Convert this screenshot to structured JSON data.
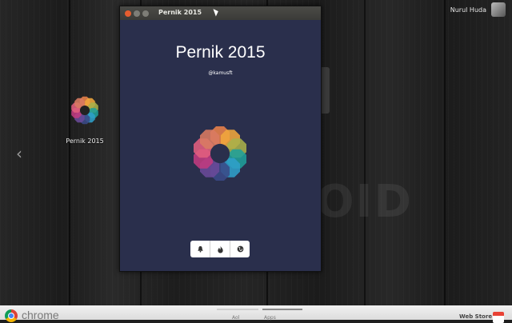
{
  "desktop": {
    "user_name": "Nurul Huda",
    "watermark": "OID",
    "nav_left_glyph": "‹",
    "app_icon_label": "Pernik 2015"
  },
  "window": {
    "title": "Pernik 2015",
    "app_title": "Pernik 2015",
    "handle": "@kamusft",
    "buttons": [
      "bell-icon",
      "fire-icon",
      "globe-icon"
    ]
  },
  "launcher": {
    "brand": "chrome",
    "page_labels": [
      "Aol",
      "Apps"
    ],
    "webstore_label": "Web Store"
  },
  "colors": {
    "window_bg": "#2a2f4c",
    "petals": [
      "#e9824a",
      "#f0a73c",
      "#a9b14a",
      "#1f9f9a",
      "#2f9fc9",
      "#3a4a87",
      "#6a4a99",
      "#c23b7f",
      "#e25e7e",
      "#d97b62"
    ]
  }
}
